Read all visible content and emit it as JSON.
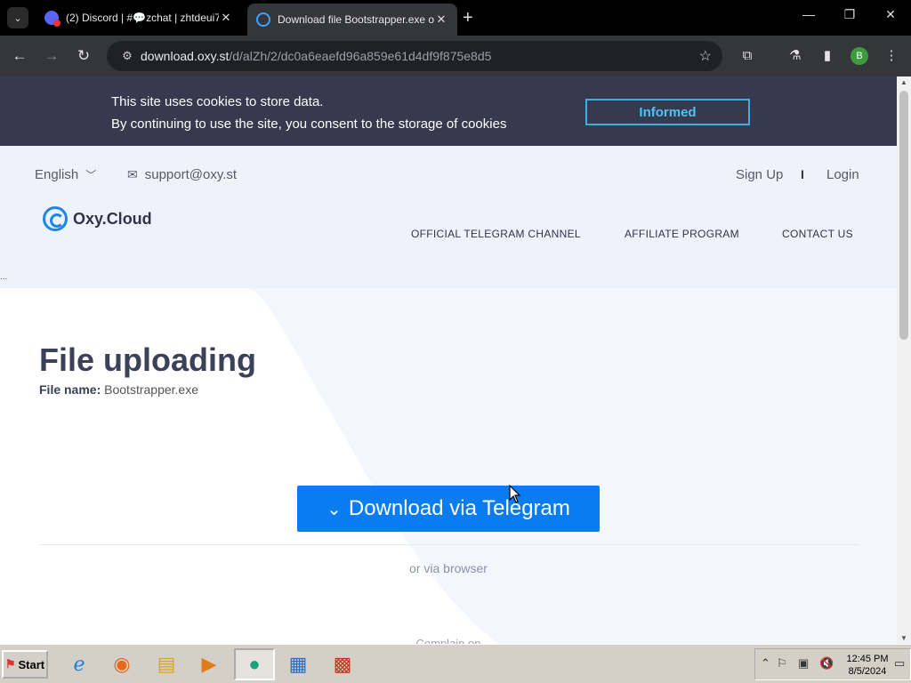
{
  "browser": {
    "tabs": [
      {
        "title": "(2) Discord | #💬zchat | zhtdeui7",
        "active": false
      },
      {
        "title": "Download file Bootstrapper.exe on",
        "active": true
      }
    ],
    "url_host": "download.oxy.st",
    "url_path": "/d/alZh/2/dc0a6eaefd96a859e61d4df9f875e8d5",
    "profile_initial": "B"
  },
  "cookie_banner": {
    "line1": "This site uses cookies to store data.",
    "line2": "By continuing to use the site, you consent to the storage of cookies",
    "button": "Informed"
  },
  "header": {
    "language": "English",
    "support_email": "support@oxy.st",
    "sign_up": "Sign Up",
    "separator": "I",
    "login": "Login",
    "logo": "Oxy.Cloud",
    "nav": [
      "OFFICIAL TELEGRAM CHANNEL",
      "AFFILIATE PROGRAM",
      "CONTACT US"
    ]
  },
  "main": {
    "dots": "...",
    "title": "File uploading",
    "file_name_label": "File name:",
    "file_name": "Bootstrapper.exe",
    "download_button": "Download via Telegram",
    "browser_link": "or via browser",
    "complain": "Complain on"
  },
  "taskbar": {
    "start": "Start",
    "time": "12:45 PM",
    "date": "8/5/2024"
  },
  "colors": {
    "cookie_bg": "#353a4f",
    "accent": "#0a7cf2",
    "informed_border": "#3bb0e0",
    "heading": "#3a4158"
  }
}
